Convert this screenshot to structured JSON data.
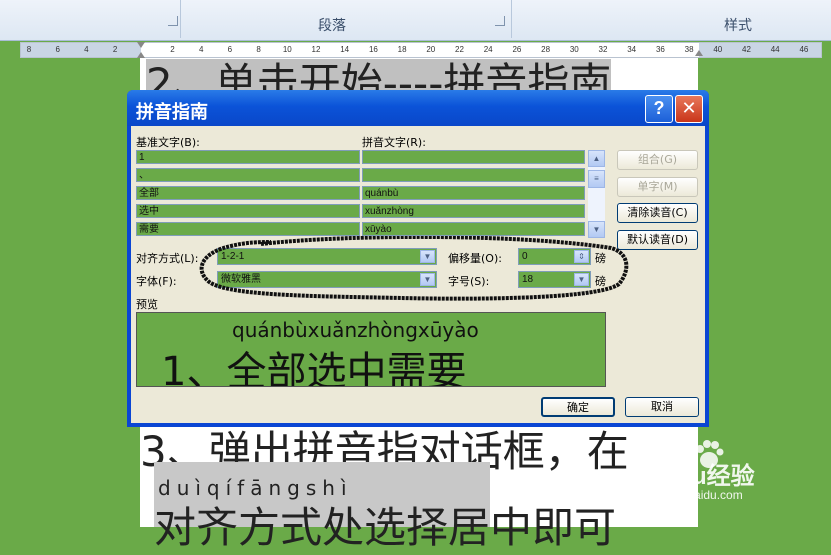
{
  "ribbon": {
    "group_paragraph": "段落",
    "group_styles": "样式"
  },
  "ruler": {
    "ticks": [
      "8",
      "6",
      "4",
      "2",
      "",
      "2",
      "4",
      "6",
      "8",
      "10",
      "12",
      "14",
      "16",
      "18",
      "20",
      "22",
      "24",
      "26",
      "28",
      "30",
      "32",
      "34",
      "36",
      "38",
      "40",
      "42",
      "44",
      "46"
    ]
  },
  "document": {
    "line_top": "2、单击开始----拼音指南",
    "line_step3": "3、弹出拼音指对话框，在",
    "pinyin_line": "duìqífāngshì",
    "line_bottom": "对齐方式处选择居中即可"
  },
  "dialog": {
    "title": "拼音指南",
    "help_button": "?",
    "close_button": "✕",
    "base_text_label": "基准文字(B):",
    "ruby_text_label": "拼音文字(R):",
    "rows": [
      {
        "base": "1",
        "ruby": ""
      },
      {
        "base": "、",
        "ruby": ""
      },
      {
        "base": "全部",
        "ruby": "quánbù"
      },
      {
        "base": "选中",
        "ruby": "xuǎnzhòng"
      },
      {
        "base": "需要",
        "ruby": "xūyào"
      }
    ],
    "buttons": {
      "group": "组合(G)",
      "mono": "单字(M)",
      "clear": "清除读音(C)",
      "default": "默认读音(D)",
      "ok": "确定",
      "cancel": "取消"
    },
    "alignment_label": "对齐方式(L):",
    "alignment_value": "1-2-1",
    "offset_label": "偏移量(O):",
    "offset_value": "0",
    "offset_unit": "磅",
    "font_label": "字体(F):",
    "font_value": "微软雅黑",
    "size_label": "字号(S):",
    "size_value": "18",
    "size_unit": "磅",
    "preview_label": "预览",
    "preview_pinyin": "quánbùxuǎnzhòngxūyào",
    "preview_text": "1、全部选中需要"
  },
  "watermark": {
    "brand": "Baidu经验",
    "url": "jingyan.baidu.com"
  },
  "colors": {
    "background_green": "#6aaa48",
    "dialog_blue": "#0a46d4",
    "close_red": "#d93b25",
    "annotation_black": "#111111"
  }
}
